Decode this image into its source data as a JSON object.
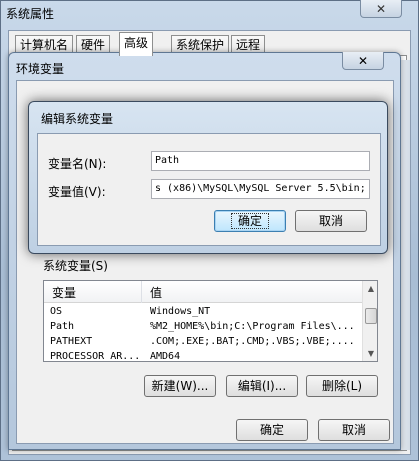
{
  "system_properties": {
    "title": "系统属性",
    "close_glyph": "✕",
    "tabs": [
      "计算机名",
      "硬件",
      "高级",
      "系统保护",
      "远程"
    ],
    "ok_label": "确定",
    "cancel_label": "取消"
  },
  "env_vars": {
    "title": "环境变量",
    "close_glyph": "✕",
    "system_vars_label": "系统变量(S)",
    "columns": [
      "变量",
      "值"
    ],
    "rows": [
      {
        "name": "OS",
        "value": "Windows_NT"
      },
      {
        "name": "Path",
        "value": "%M2_HOME%\\bin;C:\\Program Files\\..."
      },
      {
        "name": "PATHEXT",
        "value": ".COM;.EXE;.BAT;.CMD;.VBS;.VBE;...."
      },
      {
        "name": "PROCESSOR_AR...",
        "value": "AMD64"
      }
    ],
    "new_label": "新建(W)...",
    "edit_label": "编辑(I)...",
    "delete_label": "删除(L)"
  },
  "edit_dialog": {
    "title": "编辑系统变量",
    "name_label": "变量名(N):",
    "name_value": "Path",
    "value_label": "变量值(V):",
    "value_value": "s (x86)\\MySQL\\MySQL Server 5.5\\bin;",
    "ok_label": "确定",
    "cancel_label": "取消"
  },
  "colors": {
    "window_frame": "#b4c7dc",
    "client_bg": "#f0f0f0",
    "default_button_border": "#3c7fb1"
  }
}
